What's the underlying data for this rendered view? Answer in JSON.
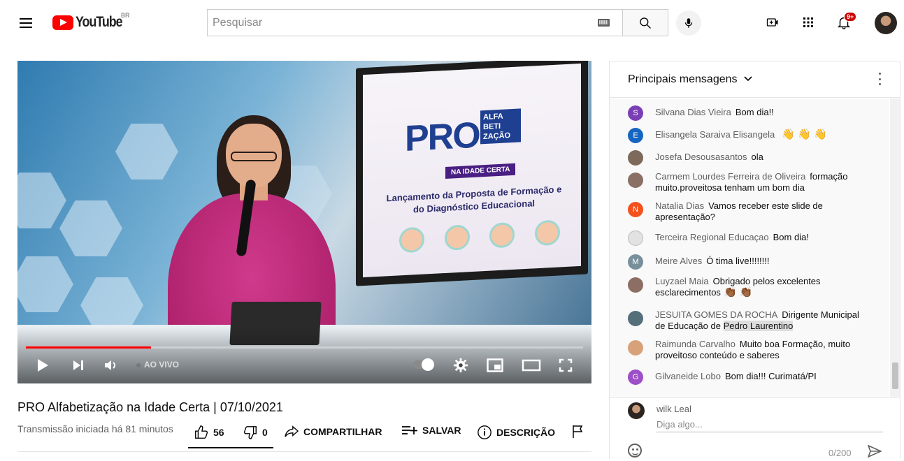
{
  "header": {
    "logo_text": "YouTube",
    "region": "BR",
    "search_placeholder": "Pesquisar",
    "notification_count": "9+"
  },
  "player": {
    "live_label": "AO VIVO",
    "progress_fraction": 0.225,
    "screen": {
      "pro": "PRO",
      "alfa_lines": "ALFA BETI ZAÇÃO",
      "idade": "NA IDADE CERTA",
      "caption": "Lançamento da Proposta de Formação e do Diagnóstico Educacional"
    }
  },
  "video": {
    "title": "PRO Alfabetização na Idade Certa | 07/10/2021",
    "meta": "Transmissão iniciada há 81 minutos",
    "likes": "56",
    "dislikes": "0",
    "share_label": "COMPARTILHAR",
    "save_label": "SALVAR",
    "description_label": "DESCRIÇÃO"
  },
  "chat": {
    "title": "Principais mensagens",
    "messages": [
      {
        "author": "Silvana Dias Vieira",
        "text": "Bom dia!!",
        "initial": "S",
        "color": "#7b3fb5"
      },
      {
        "author": "Elisangela Saraiva Elisangela",
        "text": "",
        "initial": "E",
        "color": "#1565c0",
        "claps": "👋 👋 👋"
      },
      {
        "author": "Josefa Desousasantos",
        "text": "ola",
        "initial": "",
        "color": "#7d6a5a"
      },
      {
        "author": "Carmem Lourdes Ferreira de Oliveira",
        "text": "formação muito.proveitosa tenham um bom dia",
        "initial": "",
        "color": "#8a6f65"
      },
      {
        "author": "Natalia Dias",
        "text": "Vamos receber este slide de apresentação?",
        "initial": "N",
        "color": "#f4511e"
      },
      {
        "author": "Terceira Regional Educaçao",
        "text": "Bom dia!",
        "initial": "",
        "color": "#d9d9d9"
      },
      {
        "author": "Meire Alves",
        "text": "Ó tima live!!!!!!!!",
        "initial": "M",
        "color": "#78909c"
      },
      {
        "author": "Luyzael Maia",
        "text": "Obrigado pelos excelentes esclarecimentos",
        "initial": "",
        "color": "#8d6e63",
        "claps": "👏🏾 👏🏾"
      },
      {
        "author": "JESUITA GOMES DA ROCHA",
        "text": "Dirigente Municipal de Educação de",
        "highlight": "Pedro Laurentino",
        "initial": "",
        "color": "#546e7a"
      },
      {
        "author": "Raimunda Carvalho",
        "text": "Muito boa Formação, muito proveitoso conteúdo e saberes",
        "initial": "",
        "color": "#d7a27a"
      },
      {
        "author": "Gilvaneide Lobo",
        "text": "Bom dia!!! Curimatá/PI",
        "initial": "G",
        "color": "#9c4fc7"
      }
    ],
    "composer": {
      "user": "wilk Leal",
      "placeholder": "Diga algo...",
      "char_count": "0/200"
    }
  }
}
